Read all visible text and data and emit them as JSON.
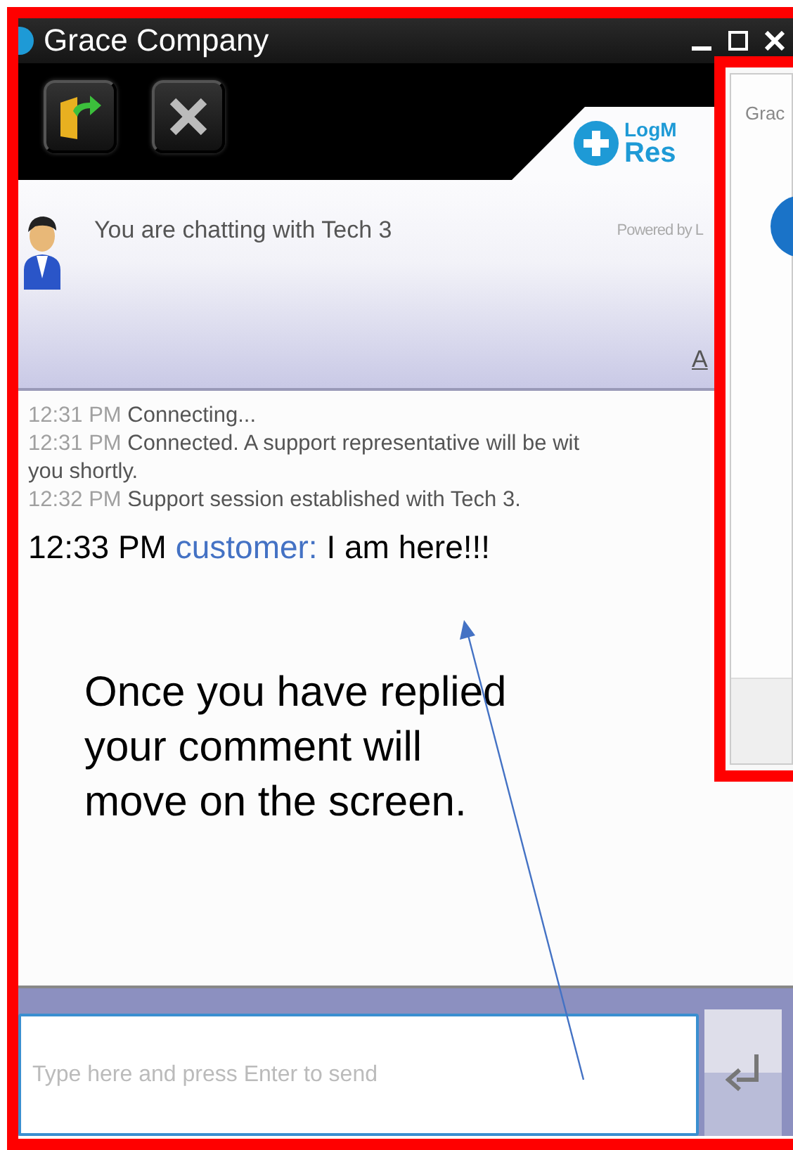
{
  "window": {
    "title": "Grace Company"
  },
  "toolbar": {
    "logo_lines": [
      "LogM",
      "Res"
    ]
  },
  "header": {
    "status": "You are chatting with Tech 3",
    "powered_by": "Powered by L",
    "font_link": "A"
  },
  "messages": [
    {
      "kind": "system",
      "time": "12:31 PM",
      "text": "Connecting..."
    },
    {
      "kind": "system",
      "time": "12:31 PM",
      "text": "Connected. A support representative will be wit",
      "continuation": "you shortly."
    },
    {
      "kind": "system",
      "time": "12:32 PM",
      "text": "Support session established with Tech 3."
    },
    {
      "kind": "highlight",
      "time": "12:33 PM",
      "sender": "customer:",
      "text": "I am here!!!"
    }
  ],
  "annotation": {
    "lines": [
      "Once you have replied",
      "your comment will",
      "move on the screen."
    ]
  },
  "input": {
    "placeholder": "Type here and press Enter to send"
  },
  "second_window": {
    "title": "Grac"
  }
}
